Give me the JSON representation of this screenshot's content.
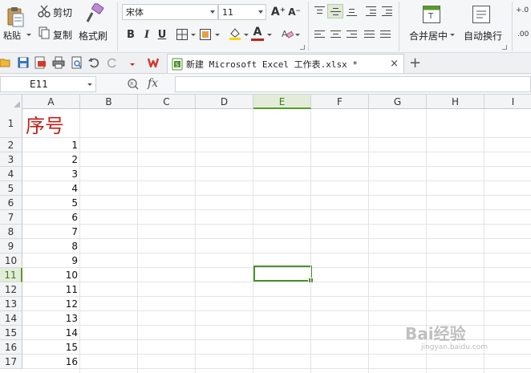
{
  "ribbon": {
    "paste_label": "粘贴",
    "cut_label": "剪切",
    "copy_label": "复制",
    "format_painter_label": "格式刷",
    "font_name": "宋体",
    "font_size": "11",
    "bold_label": "B",
    "italic_label": "I",
    "underline_label": "U",
    "font_color_label": "A",
    "increase_font_label": "A⁺",
    "decrease_font_label": "A⁻",
    "merge_center_label": "合并居中",
    "wrap_text_label": "自动换行",
    "partial_right_label": "+.0",
    "partial_right_label2": ".00"
  },
  "document_tab": {
    "title": "新建 Microsoft Excel 工作表.xlsx *",
    "close_glyph": "×",
    "new_tab_glyph": "+"
  },
  "formula_bar": {
    "name_box_value": "E11",
    "fx_label": "fx",
    "formula_value": ""
  },
  "sheet": {
    "columns": [
      "A",
      "B",
      "C",
      "D",
      "E",
      "F",
      "G",
      "H",
      "I"
    ],
    "selected_column": "E",
    "selected_row": "11",
    "row_labels": [
      "1",
      "2",
      "3",
      "4",
      "5",
      "6",
      "7",
      "8",
      "9",
      "10",
      "11",
      "12",
      "13",
      "14",
      "15",
      "16",
      "17"
    ],
    "header_text": "序号",
    "column_a_values": [
      "1",
      "2",
      "3",
      "4",
      "5",
      "6",
      "7",
      "8",
      "9",
      "10",
      "11",
      "12",
      "13",
      "14",
      "15",
      "16"
    ]
  },
  "colors": {
    "accent_green": "#4e8f2c",
    "header_red": "#c0221a"
  },
  "watermark": {
    "text": "Bai经验",
    "sub": "jingyan.baidu.com"
  }
}
